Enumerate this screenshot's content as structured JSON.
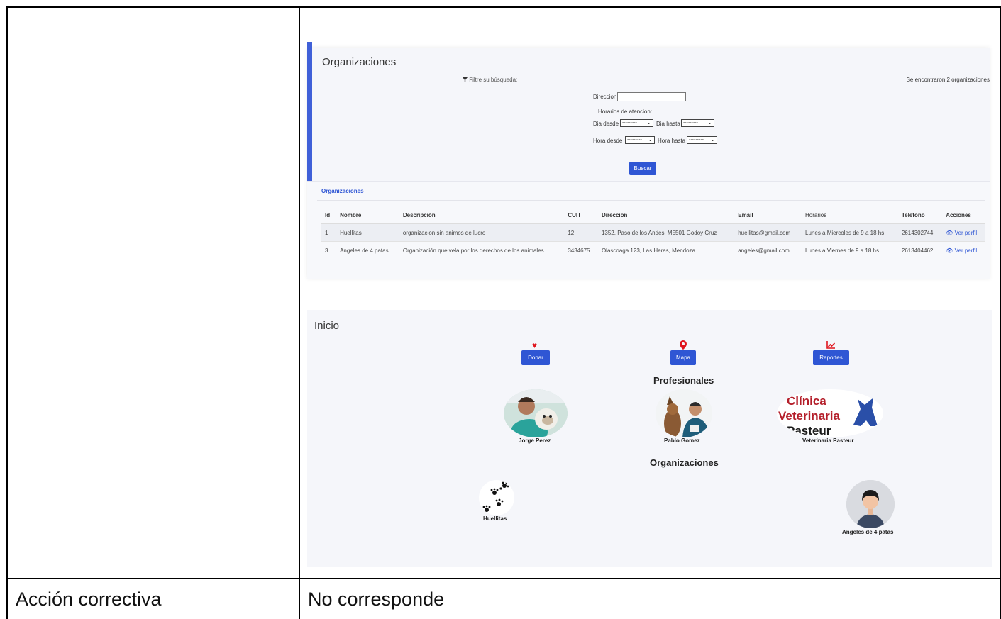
{
  "orgs_screen": {
    "title": "Organizaciones",
    "filter_label": "Filtre su búsqueda:",
    "found_text": "Se encontraron 2 organizaciones",
    "direccion_label": "Direccion",
    "horarios_label": "Horarios de atencion:",
    "dia_desde_label": "Dia desde",
    "dia_hasta_label": "Dia hasta",
    "hora_desde_label": "Hora desde",
    "hora_hasta_label": "Hora hasta",
    "select_placeholder": "---------",
    "search_button": "Buscar",
    "list_header": "Organizaciones",
    "columns": [
      "Id",
      "Nombre",
      "Descripción",
      "CUIT",
      "Direccion",
      "Email",
      "Horarios",
      "Telefono",
      "Acciones"
    ],
    "rows": [
      {
        "id": "1",
        "nombre": "Huellitas",
        "descripcion": "organizacion sin animos de lucro",
        "cuit": "12",
        "direccion": "1352, Paso de los Andes, M5501 Godoy Cruz",
        "email": "huellitas@gmail.com",
        "horarios": "Lunes a Miercoles de 9 a 18 hs",
        "telefono": "2614302744",
        "accion": "Ver perfil"
      },
      {
        "id": "3",
        "nombre": "Angeles de 4 patas",
        "descripcion": "Organización que vela por los derechos de los animales",
        "cuit": "3434675",
        "direccion": "Olascoaga 123, Las Heras, Mendoza",
        "email": "angeles@gmail.com",
        "horarios": "Lunes a Viernes de 9 a 18 hs",
        "telefono": "2613404462",
        "accion": "Ver perfil"
      }
    ]
  },
  "home_screen": {
    "title": "Inicio",
    "donar_button": "Donar",
    "mapa_button": "Mapa",
    "reportes_button": "Reportes",
    "profesionales_heading": "Profesionales",
    "profesionales": [
      "Jorge Perez",
      "Pablo Gomez",
      "Veterinaria Pasteur"
    ],
    "clinic_logo_text": [
      "Clínica",
      "Veterinaria",
      "Pasteur"
    ],
    "organizaciones_heading": "Organizaciones",
    "organizaciones": [
      "Huellitas",
      "Angeles de 4 patas"
    ],
    "accent_color": "#2f56d4",
    "icon_color": "#e0141c"
  },
  "doc_row": {
    "label": "Acción correctiva",
    "value": "No corresponde"
  }
}
